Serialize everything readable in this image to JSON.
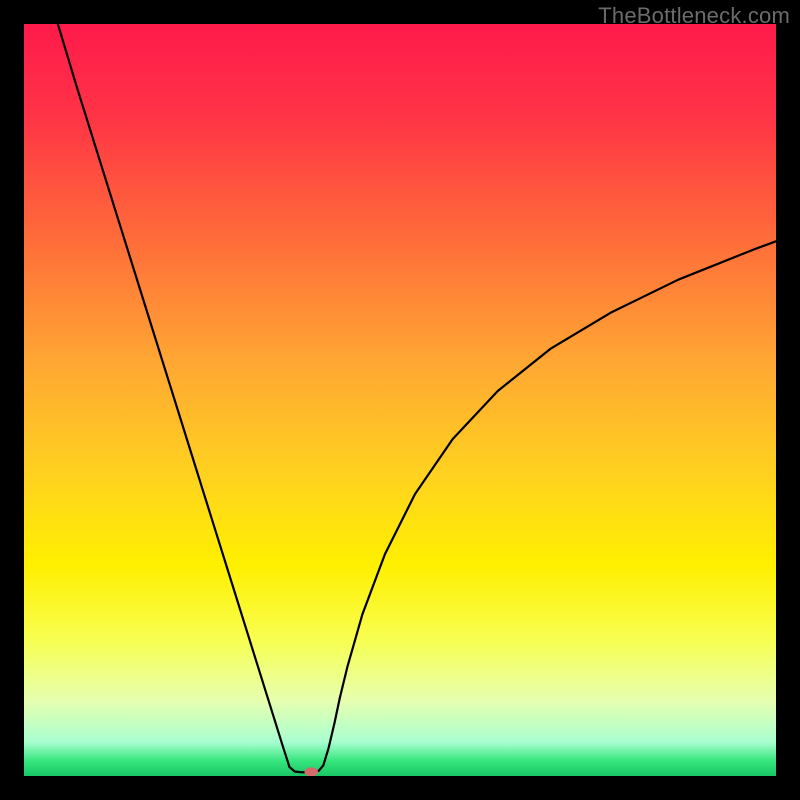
{
  "watermark": "TheBottleneck.com",
  "chart_data": {
    "type": "line",
    "title": "",
    "xlabel": "",
    "ylabel": "",
    "xlim": [
      0,
      100
    ],
    "ylim": [
      0,
      100
    ],
    "grid": false,
    "gradient_stops": [
      {
        "offset": 0.0,
        "color": "#ff1a4b"
      },
      {
        "offset": 0.12,
        "color": "#ff3346"
      },
      {
        "offset": 0.28,
        "color": "#ff6a3a"
      },
      {
        "offset": 0.45,
        "color": "#ffa733"
      },
      {
        "offset": 0.6,
        "color": "#ffd21f"
      },
      {
        "offset": 0.72,
        "color": "#fff000"
      },
      {
        "offset": 0.82,
        "color": "#f7ff52"
      },
      {
        "offset": 0.9,
        "color": "#e6ffb0"
      },
      {
        "offset": 0.955,
        "color": "#a8ffd0"
      },
      {
        "offset": 0.98,
        "color": "#36e57d"
      },
      {
        "offset": 1.0,
        "color": "#18c765"
      }
    ],
    "series": [
      {
        "name": "bottleneck-curve",
        "color": "#000000",
        "width": 2.2,
        "x": [
          4.5,
          7,
          10,
          13,
          16,
          19,
          22,
          25,
          28,
          31,
          33,
          34.5,
          35.3,
          36,
          36.8,
          38,
          38.8,
          39.2,
          39.8,
          40.5,
          41.3,
          42,
          43,
          45,
          48,
          52,
          57,
          63,
          70,
          78,
          87,
          97,
          100
        ],
        "y": [
          100,
          91.7,
          82.1,
          72.5,
          62.9,
          53.3,
          43.7,
          34.1,
          24.5,
          14.9,
          8.5,
          3.7,
          1.2,
          0.6,
          0.5,
          0.5,
          0.6,
          0.7,
          1.4,
          3.7,
          7.1,
          10.4,
          14.5,
          21.5,
          29.5,
          37.5,
          44.8,
          51.2,
          56.8,
          61.6,
          66.0,
          70.0,
          71.1
        ]
      }
    ],
    "marker": {
      "x": 38.2,
      "y": 0.55,
      "rx": 0.9,
      "ry": 0.62,
      "color": "#d46a6a"
    }
  }
}
